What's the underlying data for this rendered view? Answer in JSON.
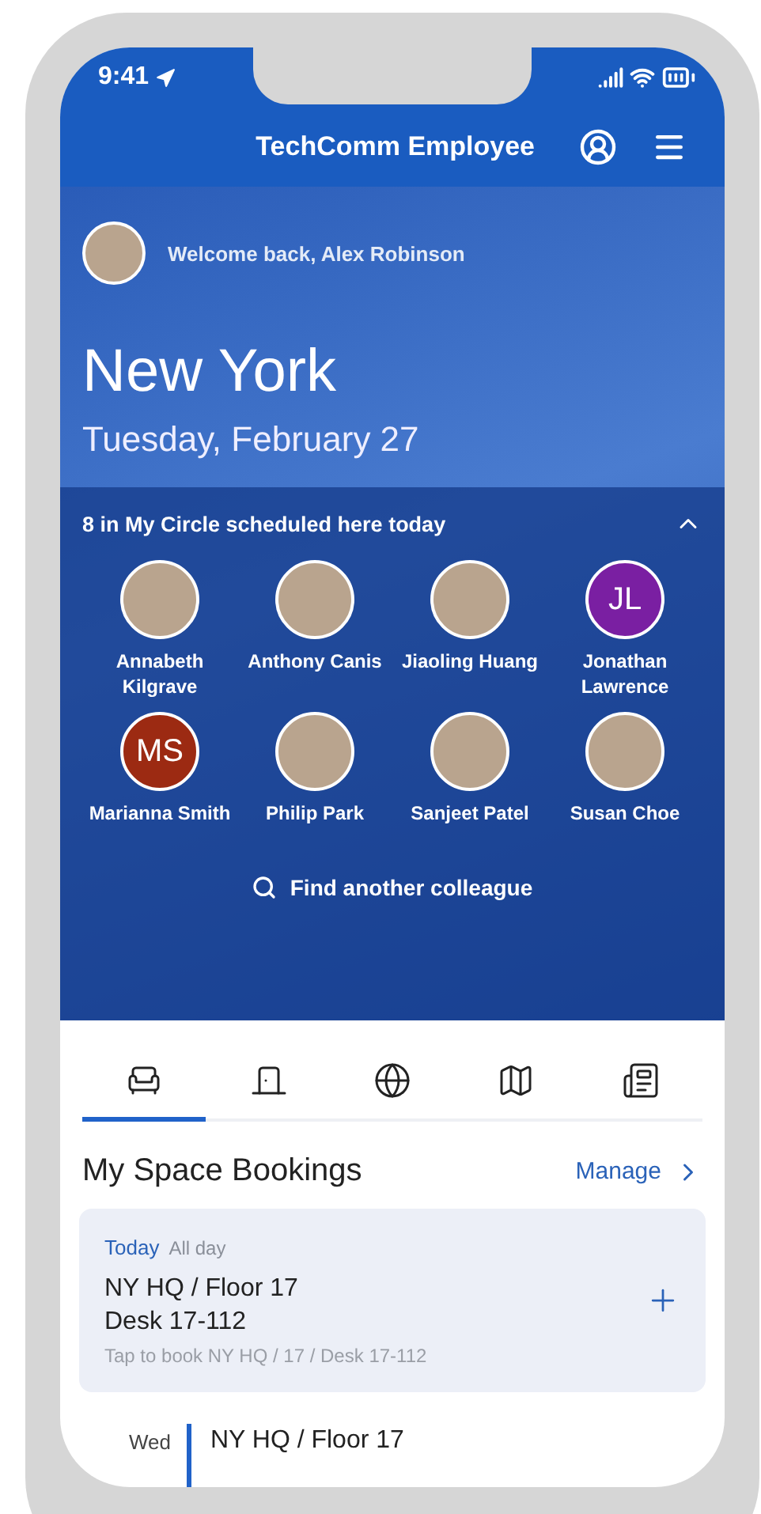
{
  "status_bar": {
    "time": "9:41"
  },
  "header": {
    "title": "TechComm Employee"
  },
  "hero": {
    "welcome": "Welcome back, Alex Robinson",
    "city": "New York",
    "date": "Tuesday, February 27"
  },
  "circle": {
    "title": "8 in My Circle scheduled here today",
    "expanded": true,
    "people": [
      {
        "name": "Annabeth Kilgrave",
        "kind": "photo"
      },
      {
        "name": "Anthony Canis",
        "kind": "photo"
      },
      {
        "name": "Jiaoling Huang",
        "kind": "photo"
      },
      {
        "name": "Jonathan Lawrence",
        "kind": "initials",
        "initials": "JL",
        "color": "#7a1fa2"
      },
      {
        "name": "Marianna Smith",
        "kind": "initials",
        "initials": "MS",
        "color": "#9c2a12"
      },
      {
        "name": "Philip Park",
        "kind": "photo"
      },
      {
        "name": "Sanjeet Patel",
        "kind": "photo"
      },
      {
        "name": "Susan Choe",
        "kind": "photo"
      }
    ],
    "find": "Find another colleague"
  },
  "tabs": [
    {
      "selected": true
    },
    {
      "selected": false
    },
    {
      "selected": false
    },
    {
      "selected": false
    },
    {
      "selected": false
    }
  ],
  "bookings": {
    "title": "My Space Bookings",
    "manage": "Manage",
    "today": {
      "day": "Today",
      "time": "All day",
      "location": "NY HQ / Floor 17",
      "desk": "Desk 17-112",
      "hint": "Tap to book NY HQ / 17 / Desk 17-112"
    },
    "upcoming": [
      {
        "day": "Wed",
        "location": "NY HQ / Floor 17"
      }
    ]
  }
}
